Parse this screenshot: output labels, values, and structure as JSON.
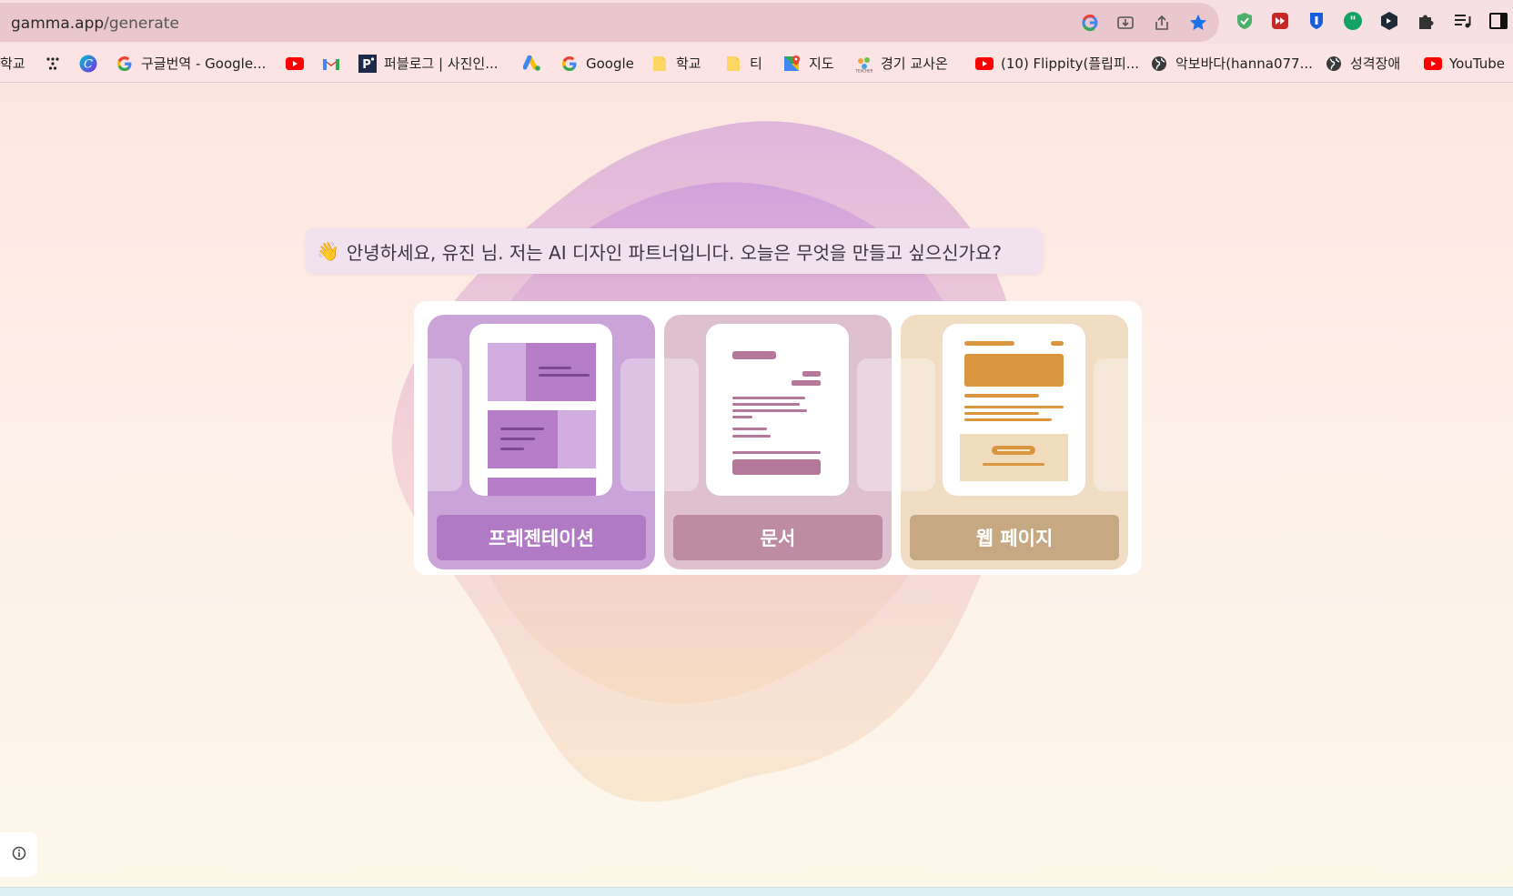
{
  "browser": {
    "url_host": "gamma.app",
    "url_path": "/generate",
    "omnibox_icons": [
      "google-lens-icon",
      "install-app-icon",
      "share-icon",
      "bookmark-star-icon"
    ],
    "extension_icons": [
      "adguard-shield-icon",
      "video-speed-icon",
      "bitwarden-icon",
      "quotes-extension-icon",
      "dark-extension-icon",
      "extensions-puzzle-icon",
      "reading-list-icon",
      "side-panel-icon"
    ]
  },
  "bookmarks": [
    {
      "label": "학교",
      "icon": "none"
    },
    {
      "label": "",
      "icon": "dots-icon"
    },
    {
      "label": "",
      "icon": "canva-icon"
    },
    {
      "label": "구글번역 - Google...",
      "icon": "google-icon"
    },
    {
      "label": "",
      "icon": "youtube-icon"
    },
    {
      "label": "",
      "icon": "gmail-icon"
    },
    {
      "label": "퍼블로그 | 사진인...",
      "icon": "p-icon"
    },
    {
      "label": "",
      "icon": "google-ads-icon"
    },
    {
      "label": "Google",
      "icon": "google-icon"
    },
    {
      "label": "학교",
      "icon": "folder-icon"
    },
    {
      "label": "티",
      "icon": "folder-icon"
    },
    {
      "label": "지도",
      "icon": "maps-icon"
    },
    {
      "label": "경기 교사온",
      "icon": "teacher-icon"
    },
    {
      "label": "(10) Flippity(플립피...",
      "icon": "youtube-icon"
    },
    {
      "label": "악보바다(hanna077...",
      "icon": "globe-icon"
    },
    {
      "label": "성격장애",
      "icon": "globe-icon"
    },
    {
      "label": "YouTube",
      "icon": "youtube-icon"
    }
  ],
  "greeting": {
    "emoji": "👋",
    "text": "안녕하세요, 유진 님. 저는 AI 디자인 파트너입니다. 오늘은 무엇을 만들고 싶으신가요?"
  },
  "options": [
    {
      "label": "프레젠테이션",
      "kind": "presentation",
      "bg": "#caa3d8",
      "button": "#b07ac4"
    },
    {
      "label": "문서",
      "kind": "document",
      "bg": "#dfc0cf",
      "button": "#bd8ca3"
    },
    {
      "label": "웹 페이지",
      "kind": "webpage",
      "bg": "#f1dcc4",
      "button": "#c6a983"
    }
  ],
  "colors": {
    "accent_purple": "#b07ac4",
    "accent_rose": "#bd8ca3",
    "accent_orange": "#d9963f"
  }
}
